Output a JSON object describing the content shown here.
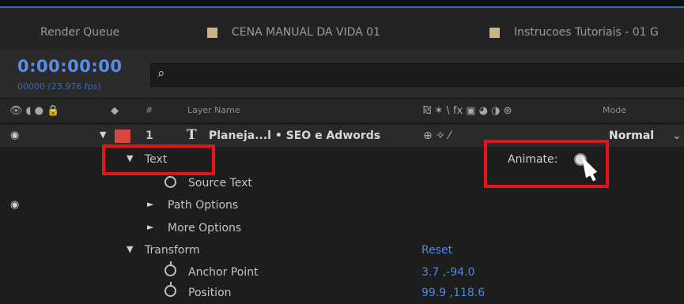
{
  "tabs": [
    {
      "label": "Render Queue"
    },
    {
      "label": "CENA MANUAL DA VIDA 01"
    },
    {
      "label": "Instrucoes Tutoriais - 01 G"
    }
  ],
  "timecode": "0:00:00:00",
  "fps": "00000 (23.976 fps)",
  "columns": {
    "layer_name": "Layer Name",
    "switches": "₪ ✶ \\ fx ▣ ◕ ◑ ⊛",
    "mode": "Mode"
  },
  "layer": {
    "number": "1",
    "type_icon": "T",
    "name": "Planeja...l • SEO e Adwords",
    "mode": "Normal"
  },
  "props": {
    "text": "Text",
    "animate": "Animate:",
    "source_text": "Source Text",
    "path_options": "Path Options",
    "more_options": "More Options",
    "transform": "Transform",
    "transform_reset": "Reset",
    "anchor_point": "Anchor Point",
    "anchor_point_value": "3.7 ,-94.0",
    "position": "Position",
    "position_value": "99.9 ,118.6"
  },
  "colors": {
    "timecode": "#5a8de6",
    "value": "#4d88dc",
    "highlight_box": "#e8131a",
    "label_swatch": "#c9b48a",
    "layer_label": "#d9453f"
  }
}
